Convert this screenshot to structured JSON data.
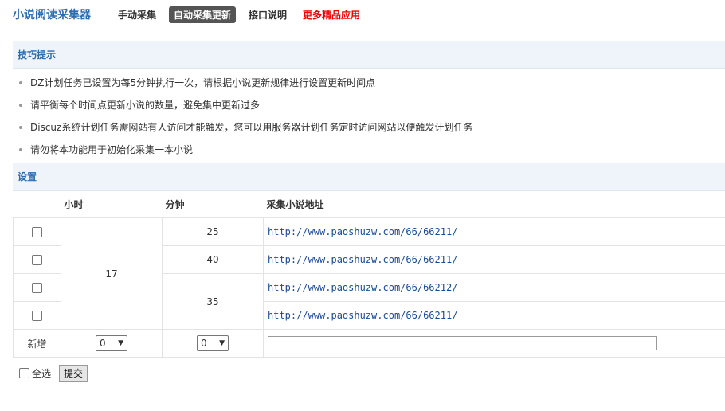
{
  "header": {
    "app_title": "小说阅读采集器",
    "nav": [
      {
        "label": "手动采集",
        "active": false,
        "highlight": false
      },
      {
        "label": "自动采集更新",
        "active": true,
        "highlight": false
      },
      {
        "label": "接口说明",
        "active": false,
        "highlight": false
      },
      {
        "label": "更多精品应用",
        "active": false,
        "highlight": true
      }
    ]
  },
  "tips": {
    "title": "技巧提示",
    "items": [
      "DZ计划任务已设置为每5分钟执行一次，请根据小说更新规律进行设置更新时间点",
      "请平衡每个时间点更新小说的数量，避免集中更新过多",
      "Discuz系统计划任务需网站有人访问才能触发，您可以用服务器计划任务定时访问网站以便触发计划任务",
      "请勿将本功能用于初始化采集一本小说"
    ]
  },
  "settings": {
    "title": "设置",
    "columns": {
      "hour": "小时",
      "minute": "分钟",
      "url": "采集小说地址"
    },
    "hour_value": "17",
    "minute_values": [
      "25",
      "40",
      "35"
    ],
    "rows": [
      {
        "url": "http://www.paoshuzw.com/66/66211/"
      },
      {
        "url": "http://www.paoshuzw.com/66/66211/"
      },
      {
        "url": "http://www.paoshuzw.com/66/66212/"
      },
      {
        "url": "http://www.paoshuzw.com/66/66211/"
      }
    ],
    "new_row": {
      "label": "新增",
      "hour_select": "0",
      "minute_select": "0",
      "url_value": ""
    }
  },
  "footer": {
    "select_all_label": "全选",
    "submit_label": "提交"
  },
  "colors": {
    "accent": "#2b6cb0",
    "highlight": "#e00000",
    "section_bg": "#eef4f9"
  }
}
